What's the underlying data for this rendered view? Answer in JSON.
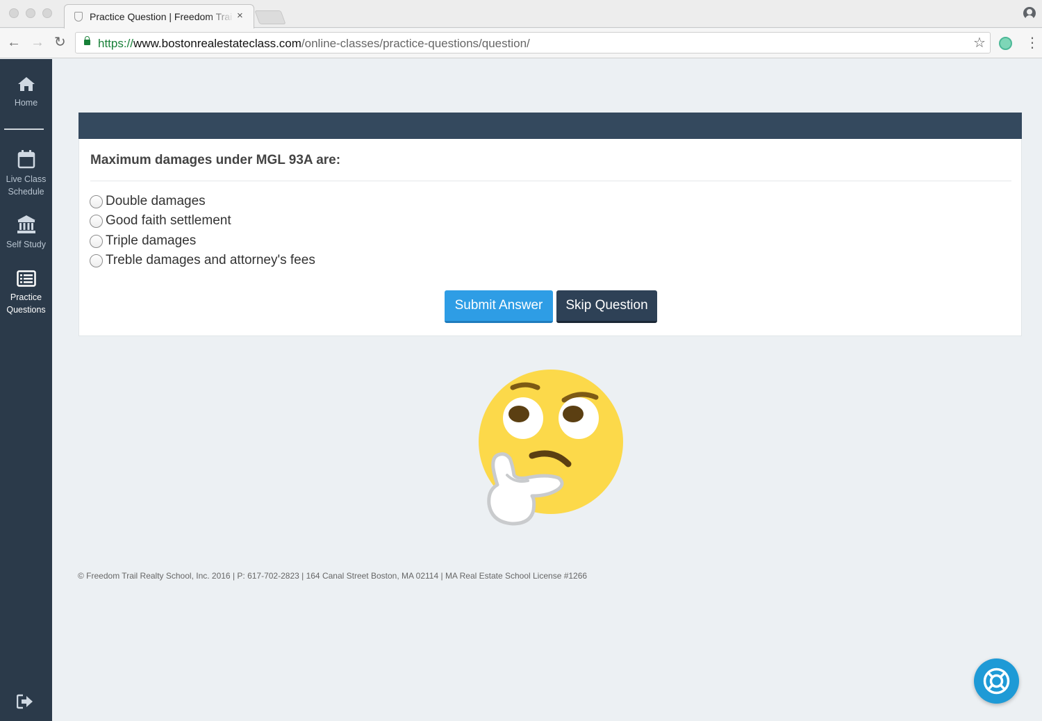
{
  "browser": {
    "tab_title": "Practice Question | Freedom Trail Realty School",
    "tab_close": "×",
    "url_scheme": "https://",
    "url_host": "www.bostonrealestateclass.com",
    "url_path": "/online-classes/practice-questions/question/",
    "back_icon": "←",
    "forward_icon": "→",
    "reload_icon": "↻",
    "star_icon": "☆",
    "menu_icon": "⋮"
  },
  "sidebar": {
    "items": [
      {
        "label": "Home",
        "icon": "home-icon"
      },
      {
        "label": "Live Class Schedule",
        "icon": "calendar-icon"
      },
      {
        "label": "Self Study",
        "icon": "bank-icon"
      },
      {
        "label": "Practice Questions",
        "icon": "list-icon",
        "active": true
      }
    ],
    "logout_icon": "logout-icon"
  },
  "question": {
    "text": "Maximum damages under MGL 93A are:",
    "options": [
      "Double damages",
      "Good faith settlement",
      "Triple damages",
      "Treble damages and attorney's fees"
    ],
    "submit_label": "Submit Answer",
    "skip_label": "Skip Question"
  },
  "illustration": "thinking-face-emoji",
  "footer": "© Freedom Trail Realty School, Inc. 2016 | P: 617-702-2823 | 164 Canal Street Boston, MA 02114 | MA Real Estate School License #1266",
  "help_icon": "lifebuoy-icon",
  "colors": {
    "sidebar": "#2b3a4a",
    "card_header": "#34495e",
    "submit": "#2e9de5",
    "skip": "#2e4156",
    "help": "#1e9ad6",
    "page_bg": "#ecf0f3"
  }
}
